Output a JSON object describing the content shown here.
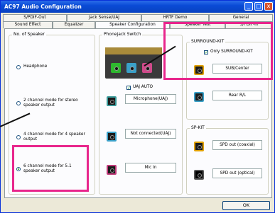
{
  "window": {
    "title": "AC97 Audio Configuration",
    "minimize": "_",
    "maximize": "□",
    "close": "x"
  },
  "tabs_back": [
    "S/PDIF-Out",
    "Jack Sense/UAJ",
    "HRTF Demo",
    "General"
  ],
  "tabs_front": [
    "Sound Effect",
    "Equalizer",
    "Speaker Configuration",
    "Speaker Test",
    "S/PDIF-In"
  ],
  "speaker_group": {
    "title": "No. of Speaker",
    "options": [
      {
        "label": "Headphone",
        "selected": false
      },
      {
        "label": "2 channel mode for stereo speaker output",
        "selected": false
      },
      {
        "label": "4 channel mode for 4 speaker output",
        "selected": false
      },
      {
        "label": "6 channel mode for 5.1 speaker output",
        "selected": true
      }
    ]
  },
  "phonejack": {
    "title": "Phonejack Switch",
    "uaj_label": "UAJ AUTO",
    "uaj_checked": true,
    "jacks": [
      {
        "label": "Microphone(UAJ)",
        "color": "#3a9a9a"
      },
      {
        "label": "Not connected(UAJ)",
        "color": "#3aa0c8"
      },
      {
        "label": "Mic In",
        "color": "#c03a7a"
      }
    ],
    "connector_colors": [
      "#2eb82e",
      "#3aa0c8",
      "#d04a8a"
    ]
  },
  "surround": {
    "title": "SURROUND-KIT",
    "only_label": "Only SURROUND-KIT",
    "only_checked": true,
    "items": [
      {
        "label": "SUB/Center",
        "color": "#e0a000"
      },
      {
        "label": "Rear R/L",
        "color": "#3aa0c8"
      }
    ]
  },
  "spkit": {
    "title": "SP-KIT",
    "items": [
      {
        "label": "SPD out (coaxial)",
        "color": "#e0a000"
      },
      {
        "label": "SPD out (optical)",
        "color": "#1b1b1b"
      }
    ]
  },
  "ok_label": "OK",
  "colors": {
    "highlight": "#e8268c",
    "titlebar": "#0a4bd6"
  }
}
